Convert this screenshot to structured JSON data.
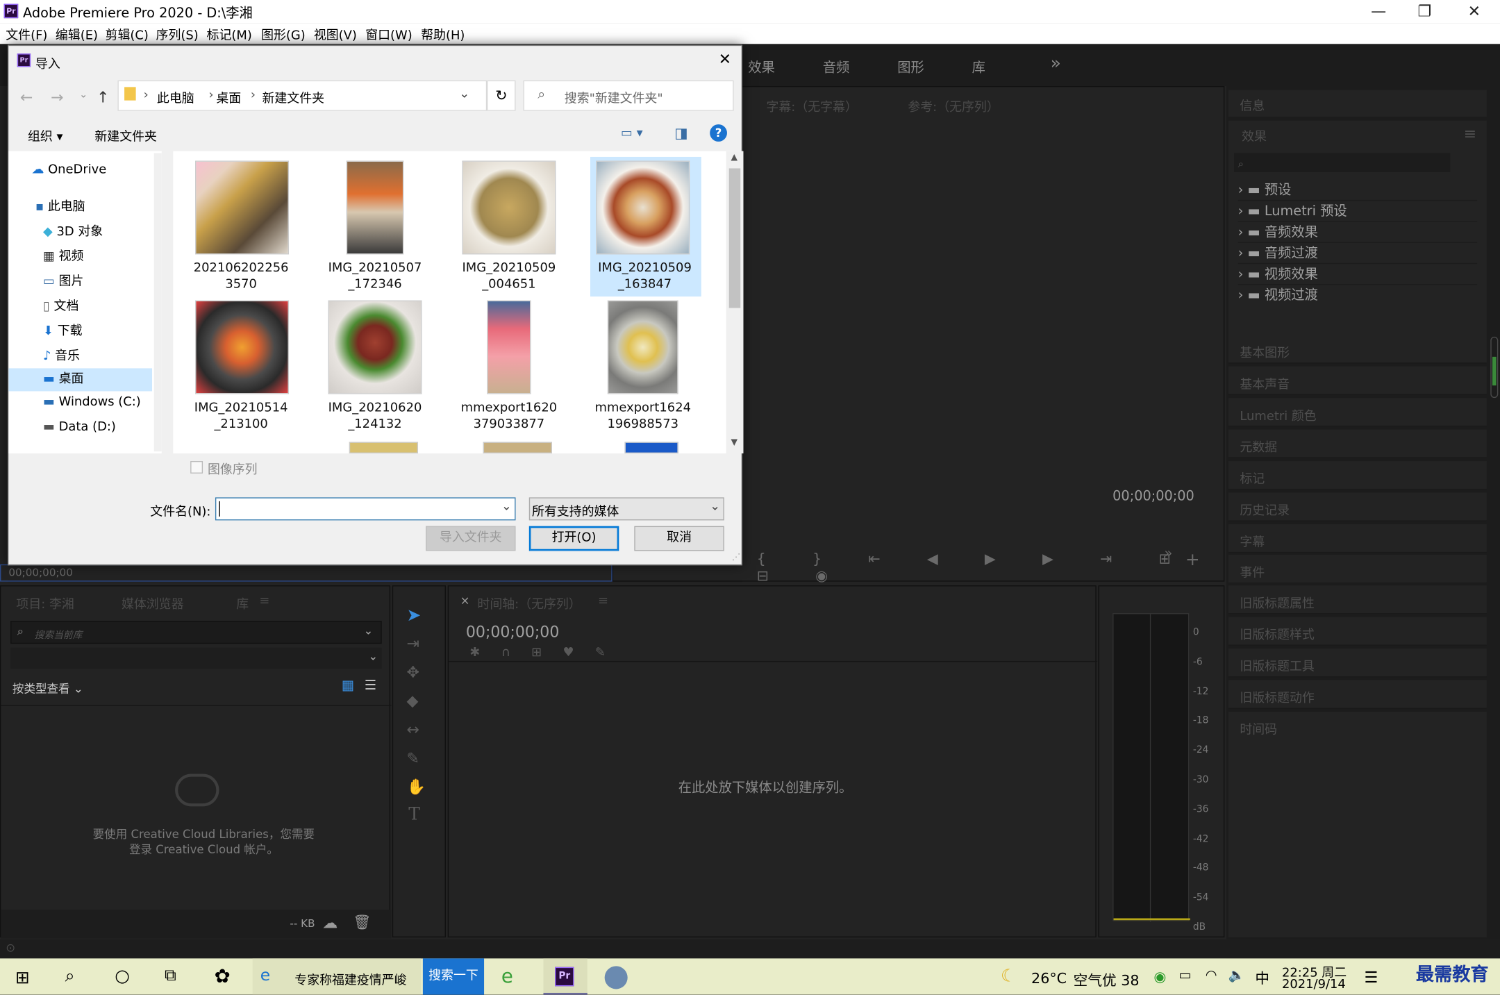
{
  "window": {
    "title": "Adobe Premiere Pro 2020 - D:\\李湘",
    "app_icon": "Pr"
  },
  "menu": [
    "文件(F)",
    "编辑(E)",
    "剪辑(C)",
    "序列(S)",
    "标记(M)",
    "图形(G)",
    "视图(V)",
    "窗口(W)",
    "帮助(H)"
  ],
  "workspace_tabs": [
    "效果",
    "音频",
    "图形",
    "库"
  ],
  "source_monitor": {
    "caption": "字幕:（无字幕）",
    "reference": "参考:（无序列）",
    "timecode": "00;00;00;00"
  },
  "program_timecode": "00;00;00;00",
  "right_panel": {
    "info": "信息",
    "effects": "效果",
    "tree": [
      "预设",
      "Lumetri 预设",
      "音频效果",
      "音频过渡",
      "视频效果",
      "视频过渡"
    ],
    "panels": [
      "基本图形",
      "基本声音",
      "Lumetri 颜色",
      "元数据",
      "标记",
      "历史记录",
      "字幕",
      "事件",
      "旧版标题属性",
      "旧版标题样式",
      "旧版标题工具",
      "旧版标题动作",
      "时间码"
    ]
  },
  "project_panel": {
    "tabs": [
      "项目: 李湘",
      "媒体浏览器",
      "库"
    ],
    "search_placeholder": "搜索当前库",
    "view_by": "按类型查看",
    "cc_message_1": "要使用 Creative Cloud Libraries，您需要",
    "cc_message_2": "登录 Creative Cloud 帐户。",
    "size": "-- KB"
  },
  "timeline": {
    "title": "时间轴:（无序列）",
    "timecode": "00;00;00;00",
    "drop_hint": "在此处放下媒体以创建序列。"
  },
  "meter": {
    "scale": [
      "0",
      "-6",
      "-12",
      "-18",
      "-24",
      "-30",
      "-36",
      "-42",
      "-48",
      "-54",
      "dB"
    ]
  },
  "dialog": {
    "title": "导入",
    "breadcrumb": [
      "此电脑",
      "桌面",
      "新建文件夹"
    ],
    "search_placeholder": "搜索\"新建文件夹\"",
    "toolbar": {
      "organize": "组织",
      "new_folder": "新建文件夹"
    },
    "nav": [
      {
        "label": "OneDrive",
        "icon": "cloud-icon"
      },
      {
        "label": "此电脑",
        "icon": "computer-icon"
      },
      {
        "label": "3D 对象",
        "icon": "cube-icon"
      },
      {
        "label": "视频",
        "icon": "film-icon"
      },
      {
        "label": "图片",
        "icon": "picture-icon"
      },
      {
        "label": "文档",
        "icon": "document-icon"
      },
      {
        "label": "下载",
        "icon": "download-icon"
      },
      {
        "label": "音乐",
        "icon": "music-icon"
      },
      {
        "label": "桌面",
        "icon": "desktop-icon"
      },
      {
        "label": "Windows (C:)",
        "icon": "drive-icon"
      },
      {
        "label": "Data (D:)",
        "icon": "drive-icon"
      }
    ],
    "files": [
      {
        "l1": "202106202256",
        "l2": "3570"
      },
      {
        "l1": "IMG_20210507",
        "l2": "_172346"
      },
      {
        "l1": "IMG_20210509",
        "l2": "_004651"
      },
      {
        "l1": "IMG_20210509",
        "l2": "_163847"
      },
      {
        "l1": "IMG_20210514",
        "l2": "_213100"
      },
      {
        "l1": "IMG_20210620",
        "l2": "_124132"
      },
      {
        "l1": "mmexport1620",
        "l2": "379033877"
      },
      {
        "l1": "mmexport1624",
        "l2": "196988573"
      }
    ],
    "image_sequence": "图像序列",
    "filename_label": "文件名(N):",
    "filename_value": "",
    "filter": "所有支持的媒体",
    "import_folder": "导入文件夹",
    "open": "打开(O)",
    "cancel": "取消"
  },
  "taskbar": {
    "news": "专家称福建疫情严峻",
    "search_btn": "搜索一下",
    "weather": "26°C",
    "air": "空气优 38",
    "ime": "中",
    "time": "22:25 周二",
    "date": "2021/9/14",
    "watermark": "最需教育"
  }
}
